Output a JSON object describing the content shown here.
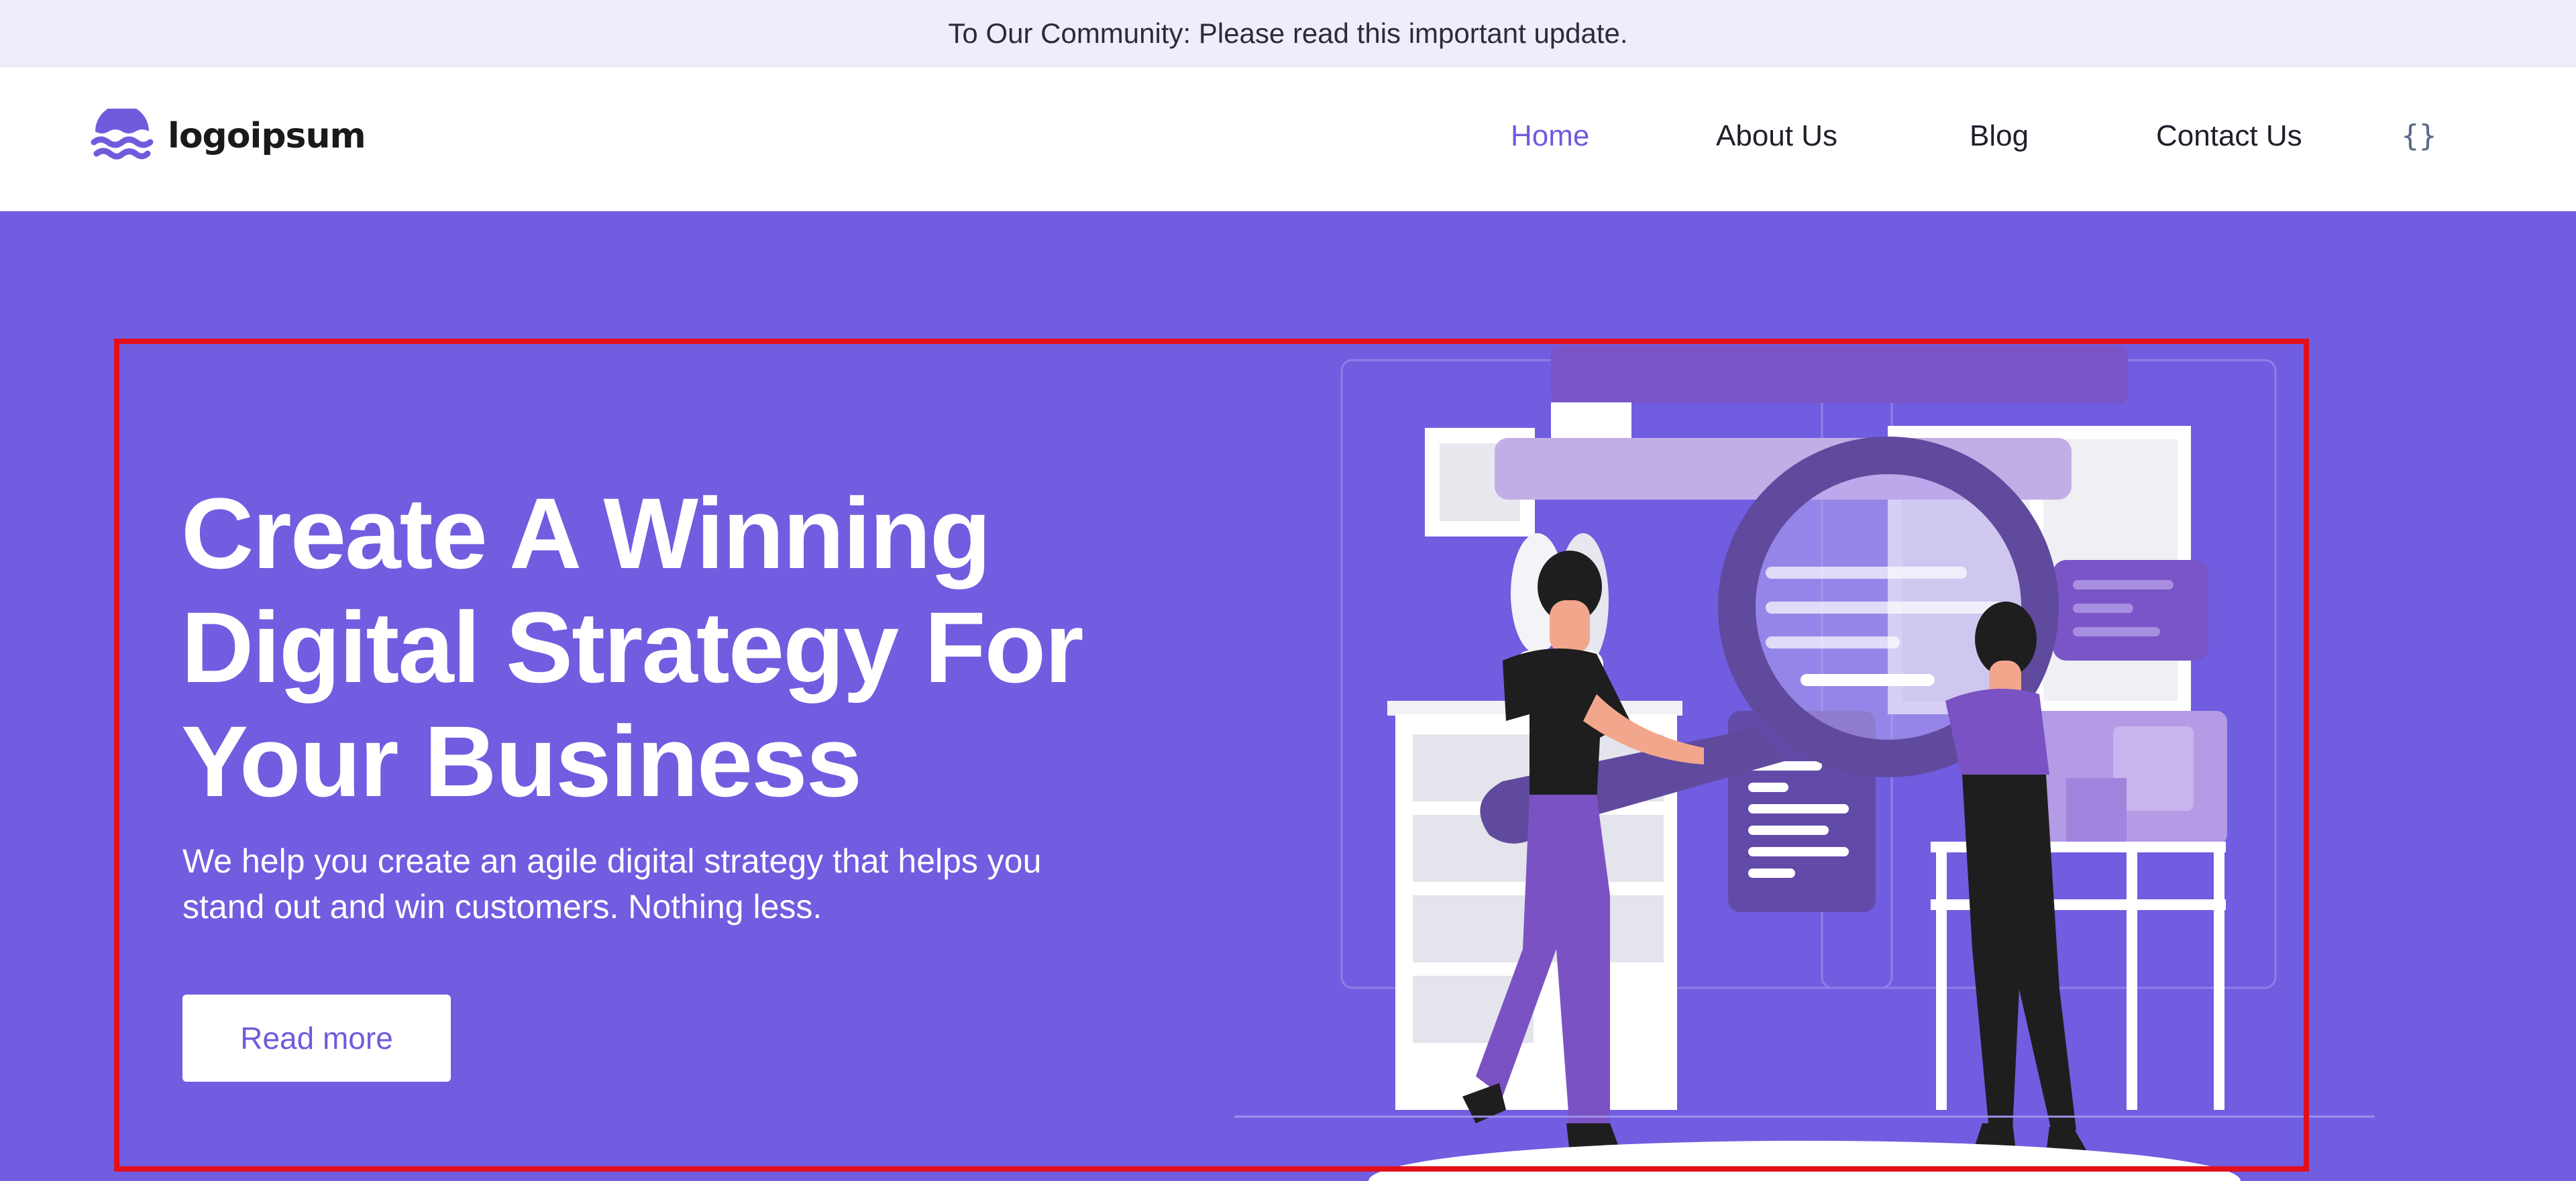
{
  "announcement": {
    "text": "To Our Community: Please read this important update."
  },
  "brand": {
    "name": "logoipsum",
    "logo_icon": "waves-logo-icon"
  },
  "nav": {
    "items": [
      {
        "label": "Home",
        "active": true
      },
      {
        "label": "About Us",
        "active": false
      },
      {
        "label": "Blog",
        "active": false
      },
      {
        "label": "Contact Us",
        "active": false
      }
    ],
    "code_icon": "{}"
  },
  "hero": {
    "title_lines": [
      "Create A Winning",
      "Digital Strategy For",
      "Your Business"
    ],
    "subtitle_lines": [
      "We help you create an agile digital strategy that helps you",
      "stand out and win customers. Nothing less."
    ],
    "cta_label": "Read more",
    "illustration": "two-people-magnifying-glass-illustration"
  },
  "colors": {
    "hero_bg": "#705de0",
    "accent": "#6f5cdc",
    "announcement_bg": "#efedfb",
    "highlight_border": "#e3101b"
  }
}
